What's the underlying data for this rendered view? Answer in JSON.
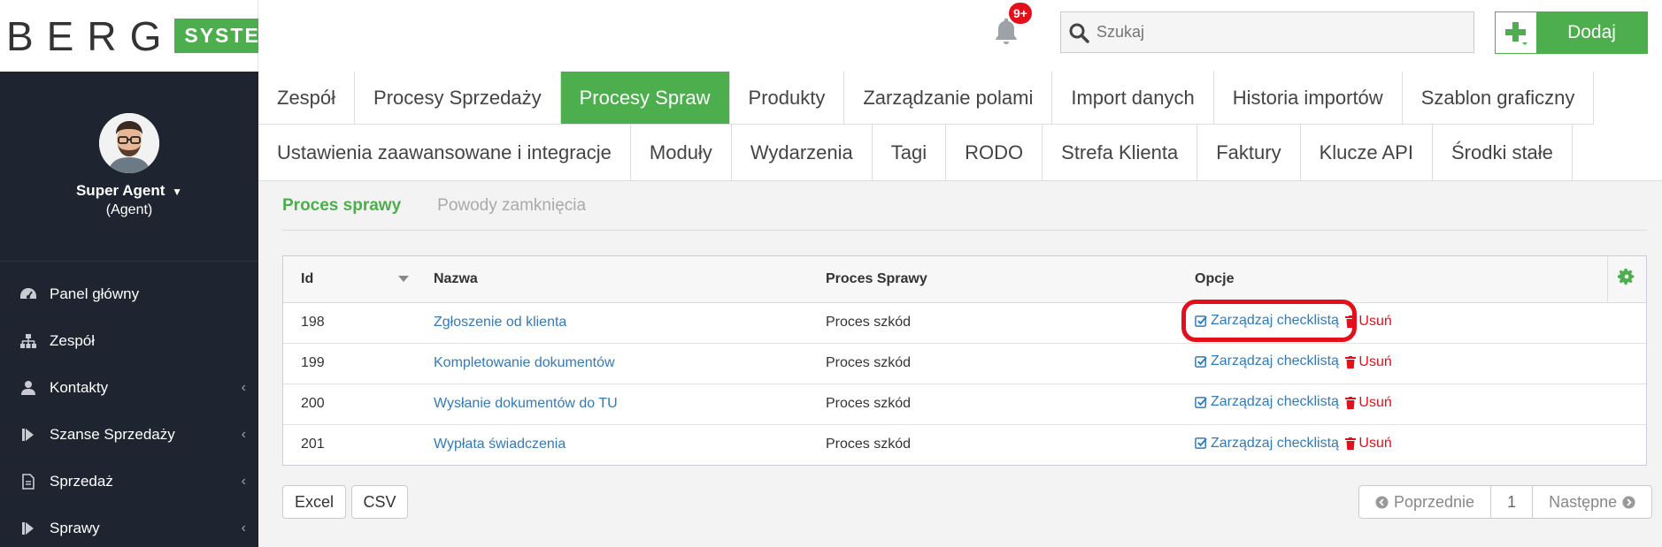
{
  "brand": {
    "name": "BERG",
    "tag": "SYSTEM"
  },
  "header": {
    "notifications_badge": "9+",
    "search_placeholder": "Szukaj",
    "add_label": "Dodaj"
  },
  "user": {
    "name": "Super Agent",
    "role": "(Agent)"
  },
  "sidebar": {
    "items": [
      {
        "label": "Panel główny",
        "icon": "dashboard-icon"
      },
      {
        "label": "Zespół",
        "icon": "sitemap-icon"
      },
      {
        "label": "Kontakty",
        "icon": "user-icon"
      },
      {
        "label": "Szanse Sprzedaży",
        "icon": "step-forward-icon"
      },
      {
        "label": "Sprzedaż",
        "icon": "document-icon"
      },
      {
        "label": "Sprawy",
        "icon": "step-forward-icon"
      }
    ]
  },
  "tabs": {
    "row1": [
      "Zespół",
      "Procesy Sprzedaży",
      "Procesy Spraw",
      "Produkty",
      "Zarządzanie polami",
      "Import danych",
      "Historia importów",
      "Szablon graficzny"
    ],
    "row2": [
      "Ustawienia zaawansowane i integracje",
      "Moduły",
      "Wydarzenia",
      "Tagi",
      "RODO",
      "Strefa Klienta",
      "Faktury",
      "Klucze API",
      "Środki stałe"
    ],
    "active": "Procesy Spraw"
  },
  "subtabs": {
    "active": "Proces sprawy",
    "other": "Powody zamknięcia"
  },
  "table": {
    "columns": [
      "Id",
      "Nazwa",
      "Proces Sprawy",
      "Opcje"
    ],
    "option_manage": "Zarządzaj checklistą",
    "option_delete": "Usuń",
    "rows": [
      {
        "id": "198",
        "name": "Zgłoszenie od klienta",
        "process": "Proces szkód"
      },
      {
        "id": "199",
        "name": "Kompletowanie dokumentów",
        "process": "Proces szkód"
      },
      {
        "id": "200",
        "name": "Wysłanie dokumentów do TU",
        "process": "Proces szkód"
      },
      {
        "id": "201",
        "name": "Wypłata świadczenia",
        "process": "Proces szkód"
      }
    ]
  },
  "export": {
    "excel": "Excel",
    "csv": "CSV"
  },
  "pager": {
    "prev": "Poprzednie",
    "page": "1",
    "next": "Następne"
  },
  "colors": {
    "accent": "#4cae4c",
    "sidebar": "#1e2530",
    "link": "#337ab7",
    "danger": "#e3101b"
  }
}
